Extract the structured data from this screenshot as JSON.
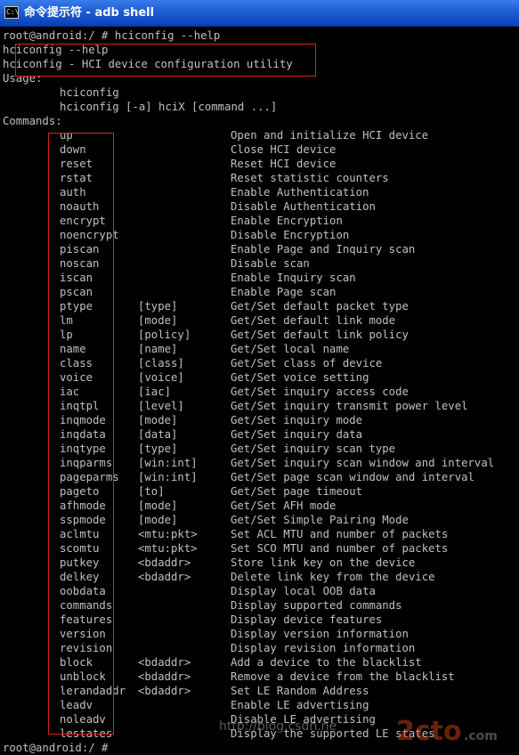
{
  "window": {
    "title": "命令提示符 - adb shell",
    "icon_text": "C:\\"
  },
  "console": {
    "prompt_command": "root@android:/ # hciconfig --help",
    "echo_line": "hciconfig --help",
    "description_line": "hciconfig - HCI device configuration utility",
    "usage_label": "Usage:",
    "usage_lines": [
      "hciconfig",
      "hciconfig [-a] hciX [command ...]"
    ],
    "commands_label": "Commands:",
    "commands": [
      {
        "name": "up",
        "param": "",
        "desc": "Open and initialize HCI device"
      },
      {
        "name": "down",
        "param": "",
        "desc": "Close HCI device"
      },
      {
        "name": "reset",
        "param": "",
        "desc": "Reset HCI device"
      },
      {
        "name": "rstat",
        "param": "",
        "desc": "Reset statistic counters"
      },
      {
        "name": "auth",
        "param": "",
        "desc": "Enable Authentication"
      },
      {
        "name": "noauth",
        "param": "",
        "desc": "Disable Authentication"
      },
      {
        "name": "encrypt",
        "param": "",
        "desc": "Enable Encryption"
      },
      {
        "name": "noencrypt",
        "param": "",
        "desc": "Disable Encryption"
      },
      {
        "name": "piscan",
        "param": "",
        "desc": "Enable Page and Inquiry scan"
      },
      {
        "name": "noscan",
        "param": "",
        "desc": "Disable scan"
      },
      {
        "name": "iscan",
        "param": "",
        "desc": "Enable Inquiry scan"
      },
      {
        "name": "pscan",
        "param": "",
        "desc": "Enable Page scan"
      },
      {
        "name": "ptype",
        "param": "[type]",
        "desc": "Get/Set default packet type"
      },
      {
        "name": "lm",
        "param": "[mode]",
        "desc": "Get/Set default link mode"
      },
      {
        "name": "lp",
        "param": "[policy]",
        "desc": "Get/Set default link policy"
      },
      {
        "name": "name",
        "param": "[name]",
        "desc": "Get/Set local name"
      },
      {
        "name": "class",
        "param": "[class]",
        "desc": "Get/Set class of device"
      },
      {
        "name": "voice",
        "param": "[voice]",
        "desc": "Get/Set voice setting"
      },
      {
        "name": "iac",
        "param": "[iac]",
        "desc": "Get/Set inquiry access code"
      },
      {
        "name": "inqtpl",
        "param": "[level]",
        "desc": "Get/Set inquiry transmit power level"
      },
      {
        "name": "inqmode",
        "param": "[mode]",
        "desc": "Get/Set inquiry mode"
      },
      {
        "name": "inqdata",
        "param": "[data]",
        "desc": "Get/Set inquiry data"
      },
      {
        "name": "inqtype",
        "param": "[type]",
        "desc": "Get/Set inquiry scan type"
      },
      {
        "name": "inqparms",
        "param": "[win:int]",
        "desc": "Get/Set inquiry scan window and interval"
      },
      {
        "name": "pageparms",
        "param": "[win:int]",
        "desc": "Get/Set page scan window and interval"
      },
      {
        "name": "pageto",
        "param": "[to]",
        "desc": "Get/Set page timeout"
      },
      {
        "name": "afhmode",
        "param": "[mode]",
        "desc": "Get/Set AFH mode"
      },
      {
        "name": "sspmode",
        "param": "[mode]",
        "desc": "Get/Set Simple Pairing Mode"
      },
      {
        "name": "aclmtu",
        "param": "<mtu:pkt>",
        "desc": "Set ACL MTU and number of packets"
      },
      {
        "name": "scomtu",
        "param": "<mtu:pkt>",
        "desc": "Set SCO MTU and number of packets"
      },
      {
        "name": "putkey",
        "param": "<bdaddr>",
        "desc": "Store link key on the device"
      },
      {
        "name": "delkey",
        "param": "<bdaddr>",
        "desc": "Delete link key from the device"
      },
      {
        "name": "oobdata",
        "param": "",
        "desc": "Display local OOB data"
      },
      {
        "name": "commands",
        "param": "",
        "desc": "Display supported commands"
      },
      {
        "name": "features",
        "param": "",
        "desc": "Display device features"
      },
      {
        "name": "version",
        "param": "",
        "desc": "Display version information"
      },
      {
        "name": "revision",
        "param": "",
        "desc": "Display revision information"
      },
      {
        "name": "block",
        "param": "<bdaddr>",
        "desc": "Add a device to the blacklist"
      },
      {
        "name": "unblock",
        "param": "<bdaddr>",
        "desc": "Remove a device from the blacklist"
      },
      {
        "name": "lerandaddr",
        "param": "<bdaddr>",
        "desc": "Set LE Random Address"
      },
      {
        "name": "leadv",
        "param": "",
        "desc": "Enable LE advertising"
      },
      {
        "name": "noleadv",
        "param": "",
        "desc": "Disable LE advertising"
      },
      {
        "name": "lestates",
        "param": "",
        "desc": "Display the supported LE states"
      }
    ],
    "final_prompt": "root@android:/ #"
  },
  "watermark": {
    "url_text": "http://blog.csdn.ne",
    "logo_text": "2cto",
    "logo_sub": ".com"
  },
  "colors": {
    "console_text": "#c0c0c0",
    "console_bg": "#000000",
    "highlight_box": "#e02020",
    "title_bar": "#0a3fb8"
  }
}
